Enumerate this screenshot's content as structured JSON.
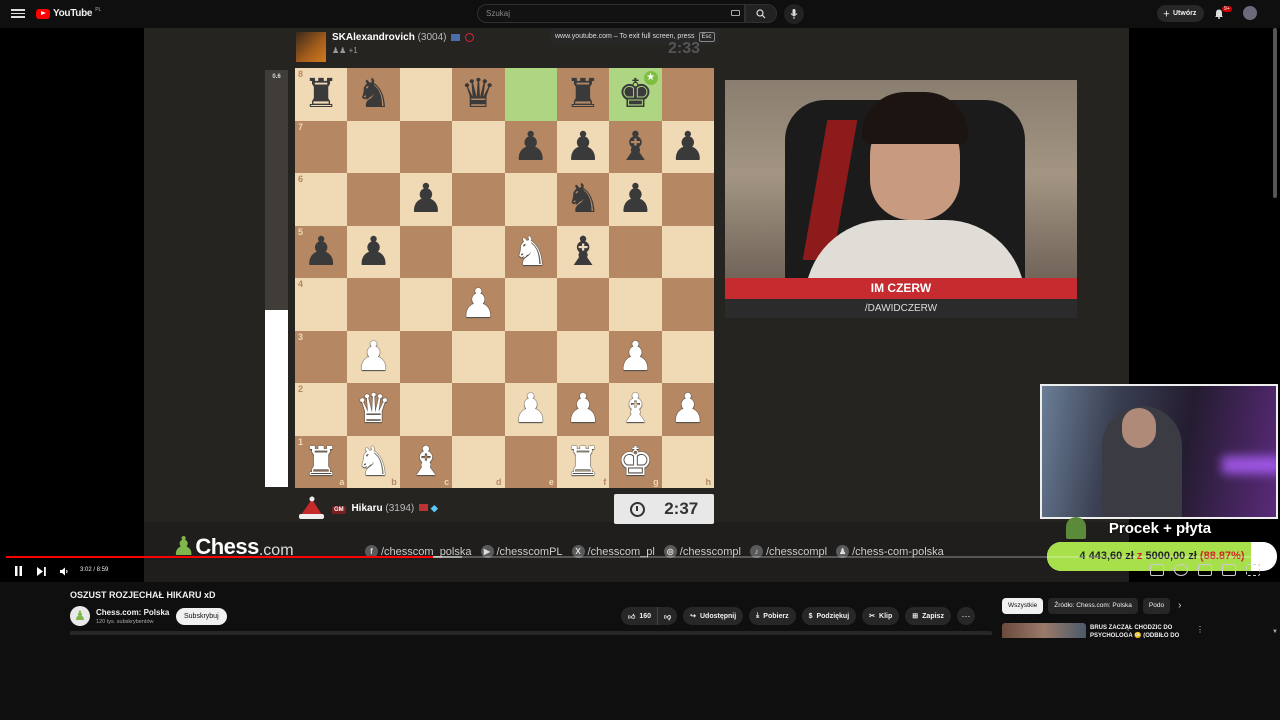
{
  "header": {
    "logo_text": "YouTube",
    "logo_region": "PL",
    "search_placeholder": "Szukaj",
    "create_label": "Utwórz",
    "notifications_badge": "9+"
  },
  "fullscreen_hint": {
    "text": "www.youtube.com – To exit full screen, press",
    "key": "Esc"
  },
  "chess": {
    "top_player": {
      "name": "SKAlexandrovich",
      "rating": "(3004)",
      "sub": "+1"
    },
    "top_clock": "2:33",
    "bottom_player": {
      "title": "GM",
      "name": "Hikaru",
      "rating": "(3194)"
    },
    "bottom_clock": "2:37",
    "eval": "0.6",
    "eval_white_fraction": 0.425,
    "ranks": [
      "8",
      "7",
      "6",
      "5",
      "4",
      "3",
      "2",
      "1"
    ],
    "files": [
      "a",
      "b",
      "c",
      "d",
      "e",
      "f",
      "g",
      "h"
    ],
    "board": [
      [
        "br",
        "bn",
        "",
        "bq",
        "",
        "br",
        "bk",
        ""
      ],
      [
        "",
        "",
        "",
        "",
        "bp",
        "bp",
        "bb",
        "bp"
      ],
      [
        "",
        "",
        "bp",
        "",
        "",
        "bn",
        "bp",
        ""
      ],
      [
        "bp",
        "bp",
        "",
        "",
        "wn",
        "bb",
        "",
        ""
      ],
      [
        "",
        "",
        "",
        "wp",
        "",
        "",
        "",
        ""
      ],
      [
        "",
        "wp",
        "",
        "",
        "",
        "",
        "wp",
        ""
      ],
      [
        "",
        "wq",
        "",
        "",
        "wp",
        "wp",
        "wb",
        "wp"
      ],
      [
        "wr",
        "wn",
        "wb",
        "",
        "",
        "wr",
        "wk",
        ""
      ]
    ],
    "highlight_squares": [
      "e8",
      "g8"
    ]
  },
  "camera": {
    "name": "IM CZERW",
    "handle": "/DAWIDCZERW"
  },
  "goal": {
    "title": "Procek + płyta",
    "current": "4 443,60 zł",
    "separator": "z",
    "target": "5000,00 zł",
    "percent_text": "(88.87%)",
    "fraction": 0.8887
  },
  "branding": {
    "logo_word": "Chess",
    "logo_suffix": ".com",
    "socials": [
      {
        "icon": "f",
        "name": "facebook-icon",
        "label": "/chesscom_polska"
      },
      {
        "icon": "▶",
        "name": "youtube-icon",
        "label": "/chesscomPL"
      },
      {
        "icon": "X",
        "name": "x-icon",
        "label": "/chesscom_pl"
      },
      {
        "icon": "◎",
        "name": "instagram-icon",
        "label": "/chesscompl"
      },
      {
        "icon": "♪",
        "name": "tiktok-icon",
        "label": "/chesscompl"
      },
      {
        "icon": "♟",
        "name": "pawn-icon",
        "label": "/chess-com-polska"
      }
    ]
  },
  "player": {
    "time": "3:02 / 8:59",
    "progress_fraction": 0.337,
    "loaded_fraction": 0.36
  },
  "video": {
    "title": "OSZUST ROZJECHAŁ HIKARU xD",
    "channel": "Chess.com: Polska",
    "subs": "120 tys. subskrybentów",
    "subscribe": "Subskrybuj",
    "likes": "160",
    "share": "Udostępnij",
    "download": "Pobierz",
    "thanks": "Podziękuj",
    "clip": "Klip",
    "save": "Zapisz",
    "more": "⋯"
  },
  "sidebar": {
    "chips": [
      "Wszystkie",
      "Źródło: Chess.com: Polska",
      "Podo"
    ],
    "rec_title": "BRUS ZACZĄŁ CHODZIĆ DO PSYCHOLOGA 😳 (ODBIŁO DO"
  }
}
